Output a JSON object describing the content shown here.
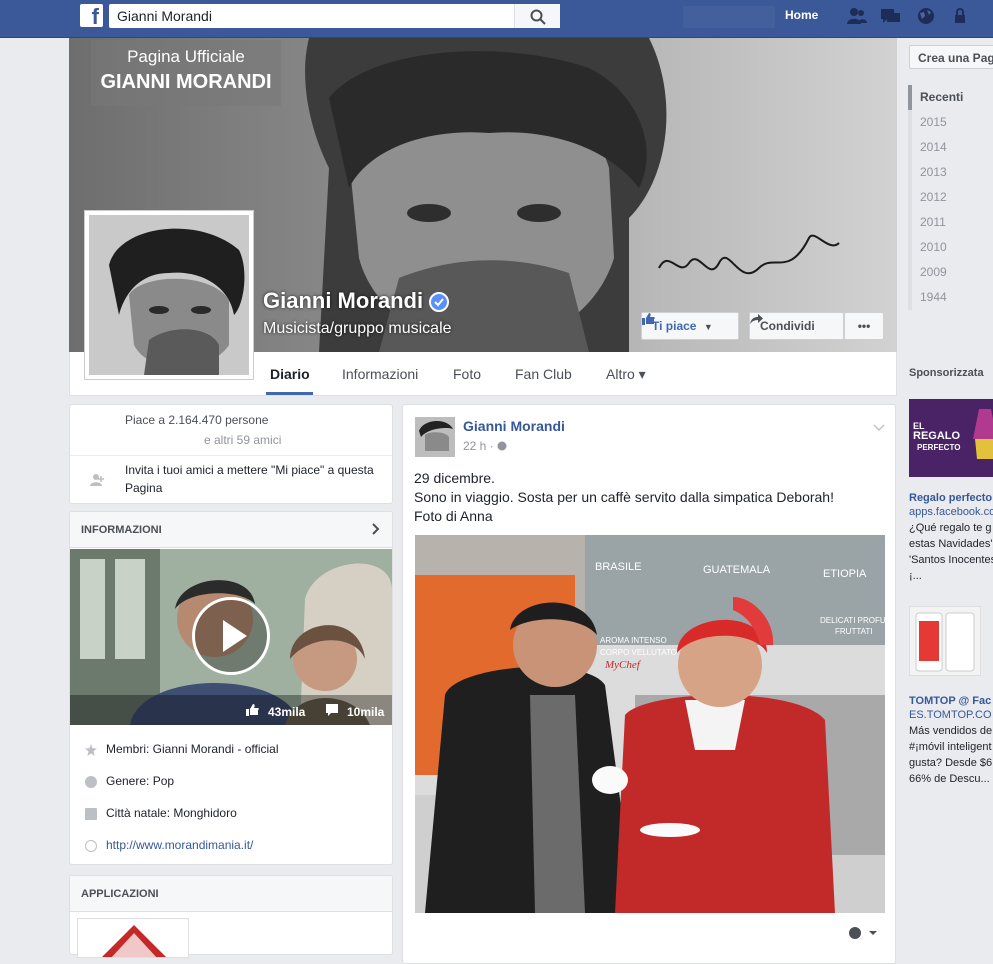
{
  "topbar": {
    "logo": "f",
    "search_value": "Gianni Morandi",
    "home_label": "Home"
  },
  "cover": {
    "badge_line1": "Pagina Ufficiale",
    "badge_line2": "GIANNI MORANDI",
    "page_name": "Gianni Morandi",
    "category": "Musicista/gruppo musicale",
    "like_button": "Ti piace",
    "share_button": "Condividi",
    "more_button": "•••"
  },
  "tabs": [
    "Diario",
    "Informazioni",
    "Foto",
    "Fan Club",
    "Altro ▾"
  ],
  "likes_card": {
    "likes_text": "Piace a 2.164.470 persone",
    "friends_text": "e altri 59 amici",
    "invite_text_1": "Invita i tuoi amici a mettere \"Mi piace\" a questa",
    "invite_text_2": "Pagina"
  },
  "info_card": {
    "title": "INFORMAZIONI",
    "video_likes": "43mila",
    "video_comments": "10mila",
    "rows": [
      {
        "icon": "star-icon",
        "text": "Membri: Gianni Morandi - official"
      },
      {
        "icon": "genre-icon",
        "text": "Genere: Pop"
      },
      {
        "icon": "home-icon",
        "text": "Città natale: Monghidoro"
      },
      {
        "icon": "globe-icon",
        "text": "http://www.morandimania.it/"
      }
    ]
  },
  "apps_card": {
    "title": "APPLICAZIONI"
  },
  "post": {
    "author": "Gianni Morandi",
    "time": "22 h · ",
    "line1": "29 dicembre.",
    "line2": "Sono in viaggio. Sosta per un caffè servito dalla simpatica Deborah!",
    "line3": "Foto di Anna",
    "photo_labels": [
      "BRASILE",
      "GUATEMALA",
      "ETIOPIA",
      "AROMA INTENSO",
      "CORPO VELLUTATO",
      "DELICATI PROFUMI",
      "FRUTTATI",
      "MyChef"
    ]
  },
  "right": {
    "create_page": "Crea una Pagina",
    "years": [
      "Recenti",
      "2015",
      "2014",
      "2013",
      "2012",
      "2011",
      "2010",
      "2009",
      "1944"
    ],
    "sponsored": "Sponsorizzata",
    "ad1": {
      "image_text_1": "EL",
      "image_text_2": "REGALO",
      "image_text_3": "PERFECTO",
      "title": "Regalo perfecto",
      "url": "apps.facebook.co",
      "desc": [
        "¿Qué regalo te g",
        "estas Navidades'",
        "'Santos Inocentes",
        "¡..."
      ]
    },
    "ad2": {
      "title": "TOMTOP @ Fac",
      "url": "ES.TOMTOP.CO",
      "desc": [
        "Más vendidos de",
        "#¡móvil inteligent",
        "gusta? Desde $6",
        "66% de Descu..."
      ]
    }
  },
  "colors": {
    "brand": "#3b5998",
    "link": "#365899",
    "verified": "#5890ff",
    "tab_underline": "#4267b2"
  }
}
